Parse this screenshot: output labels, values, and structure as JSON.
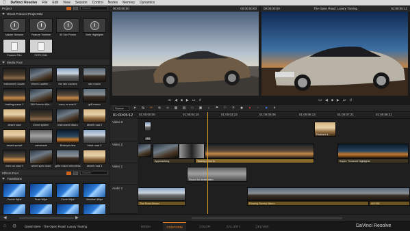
{
  "menubar": {
    "apple": "",
    "app": "DaVinci Resolve",
    "items": [
      "File",
      "Edit",
      "View",
      "Session",
      "Control",
      "Nodes",
      "Memory",
      "Dynamics"
    ]
  },
  "project": {
    "title": "Project",
    "search_placeholder": "Search",
    "bin": "Ghost Protocol Project Bin",
    "items": [
      {
        "label": "Master Session",
        "kind": "clock"
      },
      {
        "label": "Feature Timeline",
        "kind": "clock"
      },
      {
        "label": "30 Sec Promo",
        "kind": "clock"
      },
      {
        "label": "2min Highlights",
        "kind": "clock"
      },
      {
        "label": "Feature Film",
        "kind": "file"
      },
      {
        "label": "FCPX XML",
        "kind": "file"
      }
    ]
  },
  "media_pool": {
    "title": "Media Pool",
    "items": [
      {
        "label": "Instrument Cluster",
        "style": "t-int"
      },
      {
        "label": "Worrel Leather ...",
        "style": "t-car2"
      },
      {
        "label": "the rain courses",
        "style": "t-road"
      },
      {
        "label": "rain macro",
        "style": "t-car1"
      },
      {
        "label": "braking scene 1",
        "style": "t-car3"
      },
      {
        "label": "360 Exterior Mirr...",
        "style": "t-car2"
      },
      {
        "label": "merc on road 1",
        "style": "t-car3"
      },
      {
        "label": "grill macro",
        "style": "t-car1"
      },
      {
        "label": "desert road",
        "style": "t-desert"
      },
      {
        "label": "iDrive system",
        "style": "t-int"
      },
      {
        "label": "Instrument Macro",
        "style": "t-car2"
      },
      {
        "label": "desert road 2",
        "style": "t-desert"
      },
      {
        "label": "desert sunset",
        "style": "t-desert"
      },
      {
        "label": "camshade",
        "style": "t-shoot"
      },
      {
        "label": "Brakepit view",
        "style": "t-night"
      },
      {
        "label": "black road 2",
        "style": "t-road"
      },
      {
        "label": "merc on road 3",
        "style": "t-car3"
      },
      {
        "label": "wheel spec close",
        "style": "t-car2"
      },
      {
        "label": "grille macro mirrorless",
        "style": "t-car1"
      },
      {
        "label": "desert road 3",
        "style": "t-desert"
      }
    ]
  },
  "effects": {
    "title": "Effects Pool",
    "category": "Transitions",
    "items": [
      "Center Wipe",
      "Push Wipe",
      "Circle Wipe",
      "Venetian Wipe",
      "",
      "",
      "",
      ""
    ]
  },
  "source_viewer": {
    "tc_left": "00:00:00:00",
    "tc_right": "00:00:00:00"
  },
  "program_viewer": {
    "tc_left": "00:00:00:00",
    "title": "The Open Road: Luxury Touring",
    "tc_right": "01:00:05:12"
  },
  "timeline": {
    "source_select": "Source",
    "timecode": "01:00:05:12",
    "ruler": [
      "01:00:00:00",
      "01:00:04:10",
      "01:00:03:23",
      "01:00:05:06",
      "01:00:06:13",
      "01:00:07:21",
      "01:00:08:21"
    ],
    "tracks": [
      {
        "name": "Video 3"
      },
      {
        "name": "Video 2"
      },
      {
        "name": "Video 1"
      },
      {
        "name": "Audio 1"
      },
      {
        "name": "Audio 1"
      }
    ],
    "clips": {
      "v3a": "BG",
      "v3b": "Packard d...",
      "v2a": "BG",
      "v2b": "Approaching",
      "v2c": "Touring drive fs",
      "v2d": "Super: Transmit Highlights",
      "v1a": "Paced for destination",
      "a1a": "The Road Ahead",
      "a1b": "Roaring Sweep Macro",
      "v1b": "AD/180"
    }
  },
  "statusbar": {
    "user": "David Stern - The Open Road: Luxury Touring",
    "pages": [
      "MEDIA",
      "CONFORM",
      "COLOR",
      "GALLERY",
      "DELIVER"
    ],
    "active_page": "CONFORM",
    "brand": "DaVinci Resolve"
  },
  "colors": {
    "accent": "#f08020"
  }
}
